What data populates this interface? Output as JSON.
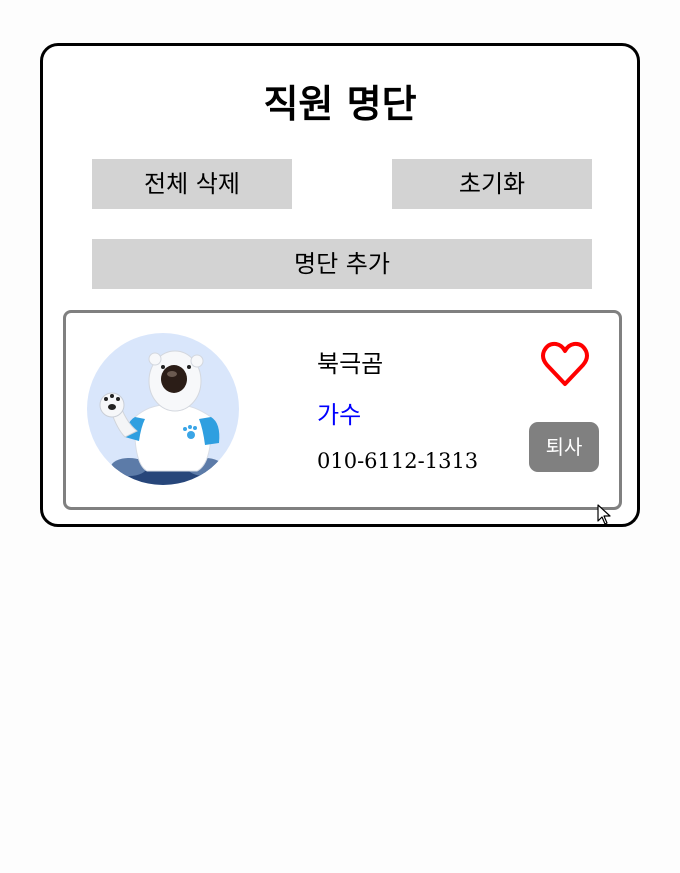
{
  "header": {
    "title": "직원 명단"
  },
  "toolbar": {
    "delete_all_label": "전체 삭제",
    "reset_label": "초기화",
    "add_label": "명단 추가"
  },
  "employees": [
    {
      "name": "북극곰",
      "job": "가수",
      "phone": "010-6112-1313",
      "leave_label": "퇴사",
      "favorite_icon": "heart-outline-icon",
      "avatar": "polar-bear-avatar"
    }
  ],
  "colors": {
    "button_bg": "#d3d3d3",
    "job_text": "#0000ff",
    "heart": "#ff0000",
    "leave_button_bg": "#808080",
    "card_border": "#808080"
  }
}
